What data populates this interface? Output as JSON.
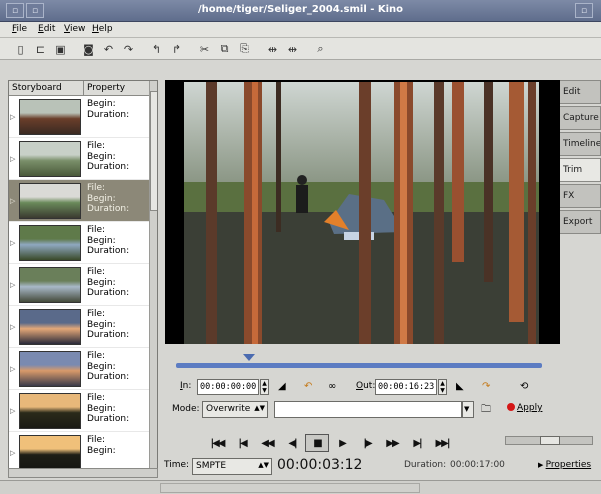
{
  "window": {
    "title": "/home/tiger/Seliger_2004.smil - Kino"
  },
  "menu": {
    "items": [
      "File",
      "Edit",
      "View",
      "Help"
    ]
  },
  "toolbar": {
    "buttons": [
      "new-icon",
      "open-icon",
      "save-icon",
      "capture-icon",
      "undo-icon",
      "redo-icon",
      "split-icon",
      "cut-icon",
      "copy-icon",
      "paste-icon",
      "insert-before-icon",
      "insert-after-icon",
      "zoom-icon"
    ]
  },
  "storyboard": {
    "headers": [
      "Storyboard",
      "Property"
    ],
    "items": [
      {
        "lines": [
          "Begin:",
          "Duration:"
        ],
        "selected": false
      },
      {
        "lines": [
          "File:",
          "Begin:",
          "Duration:"
        ],
        "selected": false
      },
      {
        "lines": [
          "File:",
          "Begin:",
          "Duration:"
        ],
        "selected": true
      },
      {
        "lines": [
          "File:",
          "Begin:",
          "Duration:"
        ],
        "selected": false
      },
      {
        "lines": [
          "File:",
          "Begin:",
          "Duration:"
        ],
        "selected": false
      },
      {
        "lines": [
          "File:",
          "Begin:",
          "Duration:"
        ],
        "selected": false
      },
      {
        "lines": [
          "File:",
          "Begin:",
          "Duration:"
        ],
        "selected": false
      },
      {
        "lines": [
          "File:",
          "Begin:",
          "Duration:"
        ],
        "selected": false
      },
      {
        "lines": [
          "File:",
          "Begin:"
        ],
        "selected": false
      }
    ]
  },
  "tabs": [
    "Edit",
    "Capture",
    "Timeline",
    "Trim",
    "FX",
    "Export"
  ],
  "active_tab": "Trim",
  "trim": {
    "in_label": "In:",
    "in_value": "00:00:00:00",
    "out_label": "Out:",
    "out_value": "00:00:16:23",
    "mode_label": "Mode:",
    "mode_value": "Overwrite",
    "apply_label": "Apply"
  },
  "transport": {
    "buttons": [
      {
        "name": "first-scene-icon",
        "glyph": "|◀◀"
      },
      {
        "name": "previous-scene-icon",
        "glyph": "|◀"
      },
      {
        "name": "rewind-icon",
        "glyph": "◀◀"
      },
      {
        "name": "step-back-icon",
        "glyph": "◀|"
      },
      {
        "name": "stop-icon",
        "glyph": "■"
      },
      {
        "name": "play-icon",
        "glyph": "▶"
      },
      {
        "name": "step-forward-icon",
        "glyph": "|▶"
      },
      {
        "name": "fast-forward-icon",
        "glyph": "▶▶"
      },
      {
        "name": "next-scene-icon",
        "glyph": "▶|"
      },
      {
        "name": "last-scene-icon",
        "glyph": "▶▶|"
      }
    ]
  },
  "status": {
    "time_label": "Time:",
    "time_format": "SMPTE",
    "timecode": "00:00:03:12",
    "duration_label": "Duration:",
    "duration_value": "00:00:17:00",
    "properties_label": "Properties"
  },
  "playhead_fraction": 0.2
}
